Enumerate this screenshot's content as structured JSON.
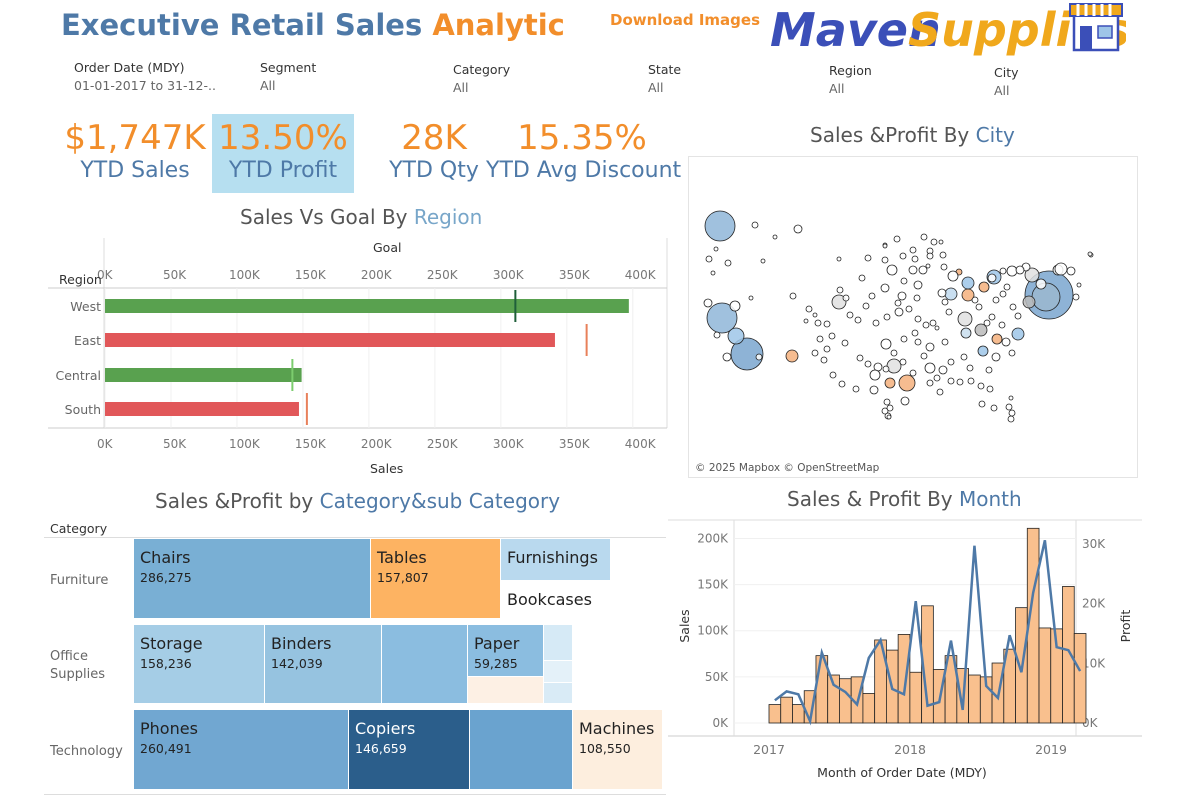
{
  "header": {
    "title_part1": "Executive Retail Sales",
    "title_part2": "Analytic",
    "download_label": "Download Images",
    "logo_text1": "Maven",
    "logo_text2": "Supplies"
  },
  "filters": [
    {
      "label": "Order Date (MDY)",
      "value": "01-01-2017 to 31-12-.."
    },
    {
      "label": "Segment",
      "value": "All"
    },
    {
      "label": "Category",
      "value": "All"
    },
    {
      "label": "State",
      "value": "All"
    },
    {
      "label": "Region",
      "value": "All"
    },
    {
      "label": "City",
      "value": "All"
    }
  ],
  "kpis": [
    {
      "value": "$1,747K",
      "label": "YTD Sales"
    },
    {
      "value": "13.50%",
      "label": "YTD Profit"
    },
    {
      "value": "28K",
      "label": "YTD Qty"
    },
    {
      "value": "15.35%",
      "label": "YTD Avg Discount"
    }
  ],
  "colors": {
    "blue": "#4e79a7",
    "orange": "#f28e2b",
    "bar_good": "#59a14f",
    "bar_bad": "#e15759",
    "kpi_highlight": "#b6dff0"
  },
  "map": {
    "title_part1": "Sales &Profit By",
    "title_part2": "City",
    "credit": "© 2025 Mapbox © OpenStreetMap"
  },
  "region_chart": {
    "title_part1": "Sales Vs Goal By",
    "title_part2": "Region",
    "chart_data": {
      "type": "bar",
      "orientation": "horizontal",
      "categories": [
        "West",
        "East",
        "Central",
        "South"
      ],
      "series": [
        {
          "name": "Sales",
          "values": [
            397000,
            341000,
            149000,
            147000
          ]
        },
        {
          "name": "Goal",
          "values": [
            311000,
            365000,
            142000,
            153000
          ]
        }
      ],
      "bar_colors": [
        "#59a14f",
        "#e15759",
        "#59a14f",
        "#e15759"
      ],
      "goal_colors": [
        "#1f5f3a",
        "#e8805a",
        "#7ccd6e",
        "#e8805a"
      ],
      "xlabel": "Sales",
      "top_axis_label": "Goal",
      "ylabel": "Region",
      "xticks": [
        "0K",
        "50K",
        "100K",
        "150K",
        "200K",
        "250K",
        "300K",
        "350K",
        "400K"
      ],
      "xlim": [
        0,
        410000
      ]
    }
  },
  "treemap": {
    "title_part1": "Sales &Profit by",
    "title_part2": "Category&sub Category",
    "category_header": "Category",
    "categories": [
      "Furniture",
      "Office Supplies",
      "Technology"
    ],
    "chart_data": {
      "type": "treemap",
      "items": [
        {
          "category": "Furniture",
          "name": "Chairs",
          "value": "286,275",
          "color": "#79afd4"
        },
        {
          "category": "Furniture",
          "name": "Tables",
          "value": "157,807",
          "color": "#fdb362"
        },
        {
          "category": "Furniture",
          "name": "Furnishings",
          "value": "",
          "color": "#b9d9ee"
        },
        {
          "category": "Furniture",
          "name": "Bookcases",
          "value": "",
          "color": "#ffffff"
        },
        {
          "category": "Office Supplies",
          "name": "Storage",
          "value": "158,236",
          "color": "#a5cde6"
        },
        {
          "category": "Office Supplies",
          "name": "Binders",
          "value": "142,039",
          "color": "#96c3e0"
        },
        {
          "category": "Office Supplies",
          "name": "",
          "value": "",
          "color": "#8bbde0"
        },
        {
          "category": "Office Supplies",
          "name": "Paper",
          "value": "59,285",
          "color": "#8bbde0"
        },
        {
          "category": "Office Supplies",
          "name": "",
          "value": "",
          "color": "#d6eaf6"
        },
        {
          "category": "Office Supplies",
          "name": "",
          "value": "",
          "color": "#fdf0e4"
        },
        {
          "category": "Office Supplies",
          "name": "",
          "value": "",
          "color": "#e4f1f9"
        },
        {
          "category": "Office Supplies",
          "name": "",
          "value": "",
          "color": "#d9ebf6"
        },
        {
          "category": "Technology",
          "name": "Phones",
          "value": "260,491",
          "color": "#71a7d1"
        },
        {
          "category": "Technology",
          "name": "Copiers",
          "value": "146,659",
          "color": "#2b5e8b"
        },
        {
          "category": "Technology",
          "name": "",
          "value": "",
          "color": "#6aa3cf"
        },
        {
          "category": "Technology",
          "name": "Machines",
          "value": "108,550",
          "color": "#fdeede"
        }
      ]
    }
  },
  "month_chart": {
    "title_part1": "Sales & Profit By",
    "title_part2": "Month",
    "chart_data": {
      "type": "bar",
      "combo": "bar+line",
      "x": [
        "2017-01",
        "2017-02",
        "2017-03",
        "2017-04",
        "2017-05",
        "2017-06",
        "2017-07",
        "2017-08",
        "2017-09",
        "2017-10",
        "2017-11",
        "2017-12",
        "2018-01",
        "2018-02",
        "2018-03",
        "2018-04",
        "2018-05",
        "2018-06",
        "2018-07",
        "2018-08",
        "2018-09",
        "2018-10",
        "2018-11",
        "2018-12"
      ],
      "series": [
        {
          "name": "Sales",
          "axis": "left",
          "values": [
            20000,
            28000,
            20000,
            35000,
            73000,
            52000,
            48000,
            50000,
            32000,
            90000,
            79000,
            96000,
            55000,
            127000,
            58000,
            73000,
            59000,
            52000,
            50000,
            65000,
            80000,
            125000,
            211000,
            103000,
            102000,
            148000,
            97000
          ]
        },
        {
          "name": "Profit",
          "axis": "right",
          "values": [
            3800,
            5300,
            4800,
            300,
            11800,
            6400,
            5200,
            3100,
            10900,
            13900,
            5700,
            4800,
            20400,
            2900,
            3500,
            13800,
            2200,
            29700,
            6200,
            4200,
            14700,
            8500,
            21800,
            30600,
            12700,
            12200,
            8700
          ]
        }
      ],
      "sales_color": "#f9c08e",
      "profit_color": "#4e79a7",
      "xlabel": "Month of Order Date (MDY)",
      "ylabel_left": "Sales",
      "ylabel_right": "Profit",
      "yticks_left": [
        "0K",
        "50K",
        "100K",
        "150K",
        "200K"
      ],
      "yticks_right": [
        "0K",
        "10K",
        "20K",
        "30K"
      ],
      "xticks": [
        "2017",
        "2018",
        "2019"
      ],
      "ylim_left": [
        0,
        220000
      ],
      "ylim_right": [
        0,
        34000
      ]
    }
  }
}
